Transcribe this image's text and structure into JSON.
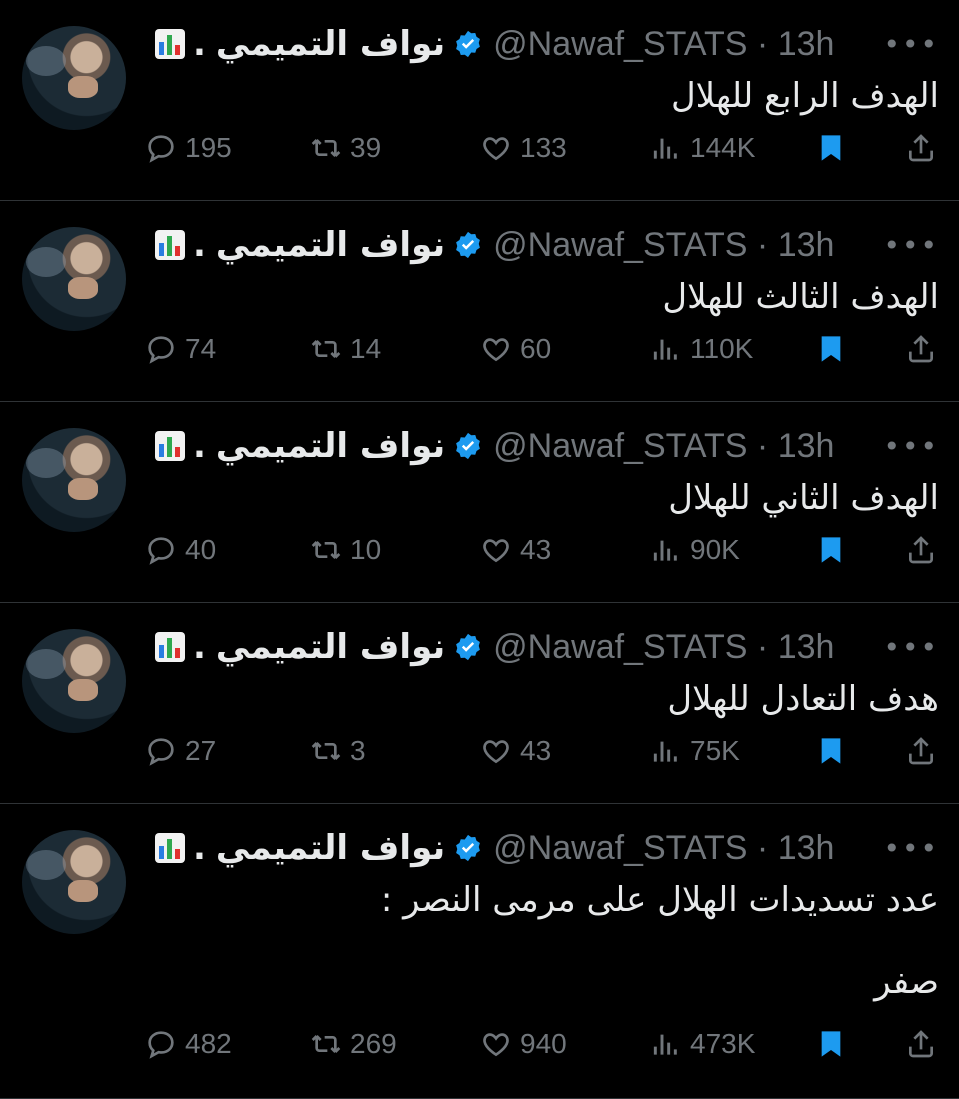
{
  "tweets": [
    {
      "name": "نواف التميمي",
      "handle": "@Nawaf_STATS · 13h",
      "text": "الهدف الرابع للهلال",
      "replies": "195",
      "retweets": "39",
      "likes": "133",
      "views": "144K"
    },
    {
      "name": "نواف التميمي",
      "handle": "@Nawaf_STATS · 13h",
      "text": "الهدف الثالث للهلال",
      "replies": "74",
      "retweets": "14",
      "likes": "60",
      "views": "110K"
    },
    {
      "name": "نواف التميمي",
      "handle": "@Nawaf_STATS · 13h",
      "text": "الهدف الثاني للهلال",
      "replies": "40",
      "retweets": "10",
      "likes": "43",
      "views": "90K"
    },
    {
      "name": "نواف التميمي",
      "handle": "@Nawaf_STATS · 13h",
      "text": "هدف التعادل للهلال",
      "replies": "27",
      "retweets": "3",
      "likes": "43",
      "views": "75K"
    },
    {
      "name": "نواف التميمي",
      "handle": "@Nawaf_STATS · 13h",
      "text": "عدد تسديدات الهلال على مرمى النصر :\n\nصفر",
      "replies": "482",
      "retweets": "269",
      "likes": "940",
      "views": "473K"
    }
  ],
  "more_label": "•••",
  "name_dot": ".",
  "icons": {
    "reply": "reply-icon",
    "retweet": "retweet-icon",
    "like": "like-icon",
    "views": "views-icon",
    "bookmark": "bookmark-icon",
    "share": "share-icon",
    "verified": "verified-icon",
    "chart_emoji": "chart-emoji-icon"
  },
  "colors": {
    "background": "#000000",
    "text": "#e7e9ea",
    "muted": "#71767b",
    "accent": "#1d9bf0",
    "divider": "#2f3336"
  }
}
